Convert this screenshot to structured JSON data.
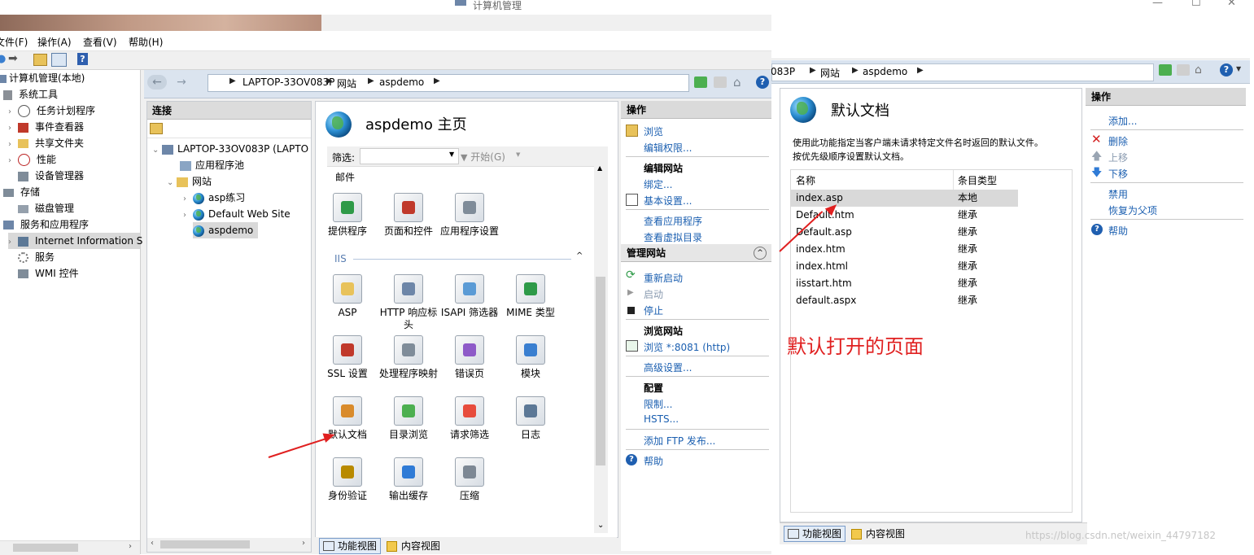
{
  "back_window": {
    "title": "计算机管理",
    "breadcrumb": [
      "083P",
      "网站",
      "aspdemo"
    ],
    "content": {
      "title": "默认文档",
      "description": [
        "使用此功能指定当客户端未请求特定文件名时返回的默认文件。",
        "按优先级顺序设置默认文档。"
      ],
      "columns": [
        "名称",
        "条目类型"
      ],
      "rows": [
        {
          "name": "index.asp",
          "type": "本地"
        },
        {
          "name": "Default.htm",
          "type": "继承"
        },
        {
          "name": "Default.asp",
          "type": "继承"
        },
        {
          "name": "index.htm",
          "type": "继承"
        },
        {
          "name": "index.html",
          "type": "继承"
        },
        {
          "name": "iisstart.htm",
          "type": "继承"
        },
        {
          "name": "default.aspx",
          "type": "继承"
        }
      ],
      "annotation": "默认打开的页面"
    },
    "actions": {
      "header": "操作",
      "add": "添加...",
      "delete": "删除",
      "move_up": "上移",
      "move_down": "下移",
      "disable": "禁用",
      "revert": "恢复为父项",
      "help": "帮助"
    },
    "tabs": {
      "feature_view": "功能视图",
      "content_view": "内容视图"
    },
    "watermark": "https://blog.csdn.net/weixin_44797182"
  },
  "front_window": {
    "menu": [
      "文件(F)",
      "操作(A)",
      "查看(V)",
      "帮助(H)"
    ],
    "tree": {
      "root": "计算机管理(本地)",
      "system_tools": "系统工具",
      "task_scheduler": "任务计划程序",
      "event_viewer": "事件查看器",
      "shared_folders": "共享文件夹",
      "performance": "性能",
      "device_manager": "设备管理器",
      "storage": "存储",
      "disk_management": "磁盘管理",
      "services_apps": "服务和应用程序",
      "iis": "Internet Information S",
      "services": "服务",
      "wmi": "WMI 控件"
    },
    "breadcrumb": [
      "LAPTOP-33OV083P",
      "网站",
      "aspdemo"
    ],
    "connections": {
      "header": "连接",
      "server": "LAPTOP-33OV083P (LAPTO",
      "app_pools": "应用程序池",
      "sites": "网站",
      "site1": "asp练习",
      "site2": "Default Web Site",
      "site3": "aspdemo"
    },
    "features": {
      "title": "aspdemo 主页",
      "filter_label": "筛选:",
      "start_label": "开始(G)",
      "cut_top_label": "邮件",
      "row1": [
        "提供程序",
        "页面和控件",
        "应用程序设置"
      ],
      "group_iis": "IIS",
      "iis_items": [
        "ASP",
        "HTTP 响应标头",
        "ISAPI 筛选器",
        "MIME 类型",
        "SSL 设置",
        "处理程序映射",
        "错误页",
        "模块",
        "默认文档",
        "目录浏览",
        "请求筛选",
        "日志",
        "身份验证",
        "输出缓存",
        "压缩"
      ]
    },
    "actions": {
      "header": "操作",
      "browse": "浏览",
      "edit_permissions": "编辑权限...",
      "edit_site_header": "编辑网站",
      "bindings": "绑定...",
      "basic_settings": "基本设置...",
      "view_apps": "查看应用程序",
      "view_vdirs": "查看虚拟目录",
      "manage_site_header": "管理网站",
      "restart": "重新启动",
      "start": "启动",
      "stop": "停止",
      "browse_site_header": "浏览网站",
      "browse_port": "浏览 *:8081 (http)",
      "advanced_settings": "高级设置...",
      "config_header": "配置",
      "limits": "限制...",
      "hsts": "HSTS...",
      "add_ftp": "添加 FTP 发布...",
      "help": "帮助"
    },
    "tabs": {
      "feature_view": "功能视图",
      "content_view": "内容视图"
    }
  }
}
